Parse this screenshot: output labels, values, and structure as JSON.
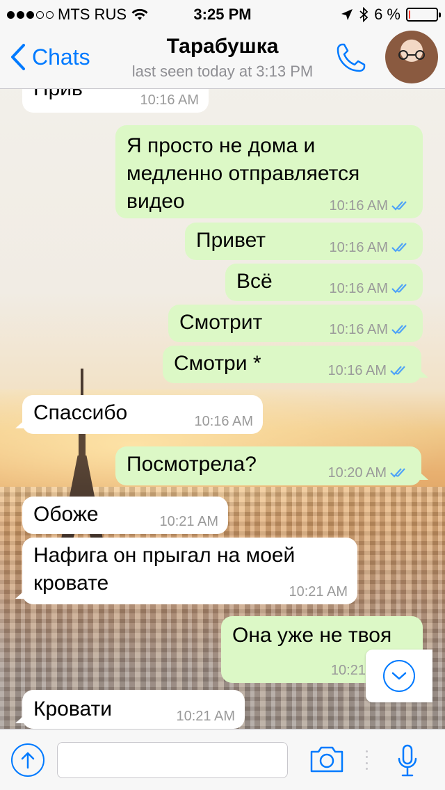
{
  "status_bar": {
    "carrier": "MTS RUS",
    "time": "3:25 PM",
    "battery_percent": "6 %",
    "battery_level": 0.06,
    "signal_bars_filled": 3,
    "signal_bars_total": 5
  },
  "header": {
    "back_label": "Chats",
    "contact_name": "Тарабушка",
    "last_seen": "last seen today at 3:13 PM"
  },
  "messages": [
    {
      "dir": "in",
      "text": "Прив",
      "time": "10:16 AM"
    },
    {
      "dir": "out",
      "text": "Я просто не дома и\nмедленно отправляется\nвидео",
      "time": "10:16 AM",
      "read": true
    },
    {
      "dir": "out",
      "text": "Привет",
      "time": "10:16 AM",
      "read": true
    },
    {
      "dir": "out",
      "text": "Всё",
      "time": "10:16 AM",
      "read": true
    },
    {
      "dir": "out",
      "text": "Смотрит",
      "time": "10:16 AM",
      "read": true
    },
    {
      "dir": "out",
      "text": "Смотри *",
      "time": "10:16 AM",
      "read": true
    },
    {
      "dir": "in",
      "text": "Спассибо",
      "time": "10:16 AM"
    },
    {
      "dir": "out",
      "text": "Посмотрела?",
      "time": "10:20 AM",
      "read": true
    },
    {
      "dir": "in",
      "text": "Обоже",
      "time": "10:21 AM"
    },
    {
      "dir": "in",
      "text": "Нафига он прыгал на моей\nкровате",
      "time": "10:21 AM"
    },
    {
      "dir": "out",
      "text": "Она уже не твоя",
      "time": "10:21",
      "read": true
    },
    {
      "dir": "in",
      "text": "Кровати",
      "time": "10:21 AM"
    }
  ],
  "input": {
    "placeholder": "",
    "value": ""
  },
  "colors": {
    "accent": "#007aff",
    "outgoing_bubble": "#dcf8c6",
    "incoming_bubble": "#ffffff",
    "read_check": "#4fa3f7",
    "battery_low": "#ff3b30"
  },
  "icons": {
    "back": "chevron-left-icon",
    "call": "phone-icon",
    "attach": "arrow-up-icon",
    "camera": "camera-icon",
    "mic": "microphone-icon",
    "scroll": "chevron-down-icon"
  }
}
